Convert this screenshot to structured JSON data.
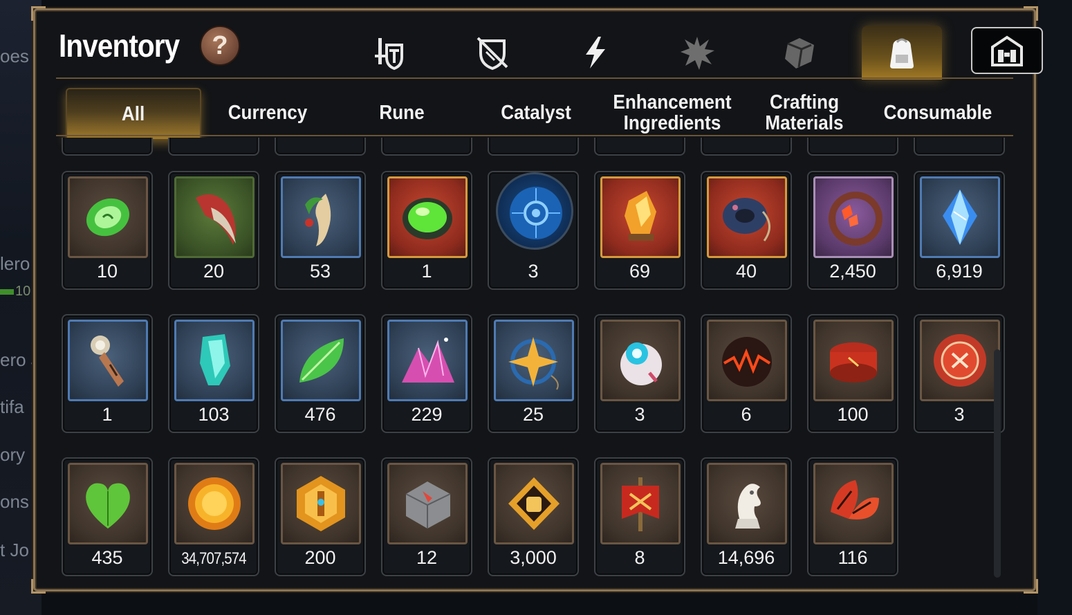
{
  "background_fragments": [
    "oes",
    "lero",
    "10",
    "ero J",
    "tifa",
    "ory",
    "ons",
    "t Jo"
  ],
  "header": {
    "title": "Inventory",
    "help_label": "?"
  },
  "category_tabs": [
    {
      "name": "equipment",
      "icon": "sword-shield-icon",
      "active": false
    },
    {
      "name": "locked-equipment",
      "icon": "crossed-shield-icon",
      "active": false
    },
    {
      "name": "skill",
      "icon": "lightning-icon",
      "active": false
    },
    {
      "name": "artifact",
      "icon": "burst-icon",
      "active": false
    },
    {
      "name": "material-box",
      "icon": "cube-icon",
      "active": false
    },
    {
      "name": "bag",
      "icon": "backpack-icon",
      "active": true
    },
    {
      "name": "storage",
      "icon": "castle-storage-icon",
      "active": false
    }
  ],
  "filter_tabs": [
    {
      "label": "All",
      "active": true
    },
    {
      "label": "Currency",
      "active": false
    },
    {
      "label": "Rune",
      "active": false
    },
    {
      "label": "Catalyst",
      "active": false
    },
    {
      "label": "Enhancement Ingredients",
      "active": false
    },
    {
      "label": "Crafting Materials",
      "active": false
    },
    {
      "label": "Consumable",
      "active": false
    }
  ],
  "items": [
    {
      "name": "green-rune-stone-icon",
      "qty": "10",
      "frame": "brown"
    },
    {
      "name": "red-claw-icon",
      "qty": "20",
      "frame": "green"
    },
    {
      "name": "ginseng-root-icon",
      "qty": "53",
      "frame": "blue"
    },
    {
      "name": "green-orb-icon",
      "qty": "1",
      "frame": "red"
    },
    {
      "name": "blue-tech-disc-icon",
      "qty": "3",
      "frame": "circle"
    },
    {
      "name": "amber-crystal-icon",
      "qty": "69",
      "frame": "red"
    },
    {
      "name": "blue-ring-pendant-icon",
      "qty": "40",
      "frame": "red"
    },
    {
      "name": "flower-ring-icon",
      "qty": "2,450",
      "frame": "purple"
    },
    {
      "name": "blue-gem-icon",
      "qty": "6,919",
      "frame": "blue"
    },
    {
      "name": "dagger-key-icon",
      "qty": "1",
      "frame": "blue"
    },
    {
      "name": "cyan-crystal-icon",
      "qty": "103",
      "frame": "blue"
    },
    {
      "name": "green-leaf-icon",
      "qty": "476",
      "frame": "blue"
    },
    {
      "name": "pink-crystal-pile-icon",
      "qty": "229",
      "frame": "blue"
    },
    {
      "name": "star-pendant-icon",
      "qty": "25",
      "frame": "blue"
    },
    {
      "name": "pet-robot-icon",
      "qty": "3",
      "frame": "brown"
    },
    {
      "name": "red-orb-icon",
      "qty": "6",
      "frame": "brown"
    },
    {
      "name": "red-band-icon",
      "qty": "100",
      "frame": "brown"
    },
    {
      "name": "red-seal-icon",
      "qty": "3",
      "frame": "brown"
    },
    {
      "name": "green-heart-icon",
      "qty": "435",
      "frame": "brown"
    },
    {
      "name": "gold-coin-icon",
      "qty": "34,707,574",
      "frame": "brown",
      "small": true
    },
    {
      "name": "gold-hex-emblem-icon",
      "qty": "200",
      "frame": "brown"
    },
    {
      "name": "stone-compass-icon",
      "qty": "12",
      "frame": "brown"
    },
    {
      "name": "fist-emblem-icon",
      "qty": "3,000",
      "frame": "brown"
    },
    {
      "name": "red-banner-icon",
      "qty": "8",
      "frame": "brown"
    },
    {
      "name": "knight-chess-icon",
      "qty": "14,696",
      "frame": "brown"
    },
    {
      "name": "red-leaf-icon",
      "qty": "116",
      "frame": "brown"
    }
  ]
}
